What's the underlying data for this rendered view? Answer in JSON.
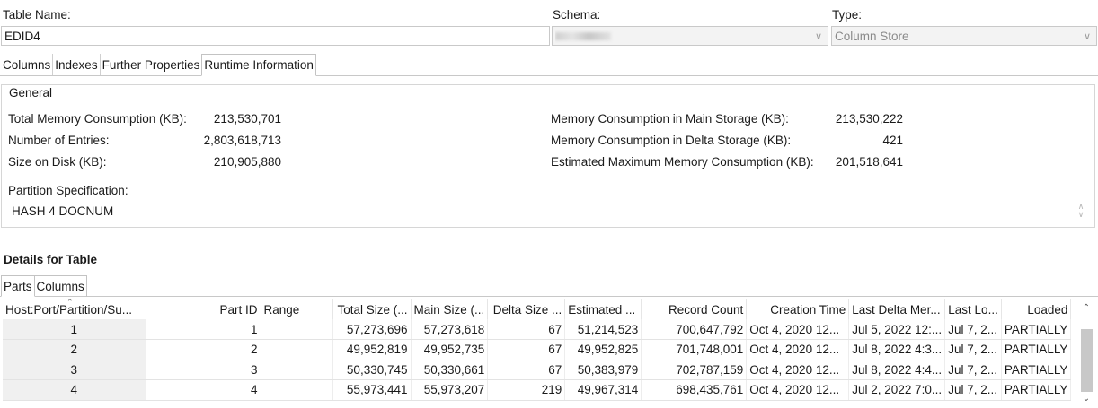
{
  "header": {
    "table_name_label": "Table Name:",
    "table_name_value": "EDID4",
    "schema_label": "Schema:",
    "type_label": "Type:",
    "type_value": "Column Store"
  },
  "tabs": [
    "Columns",
    "Indexes",
    "Further Properties",
    "Runtime Information"
  ],
  "active_tab": "Runtime Information",
  "general": {
    "title": "General",
    "left": [
      {
        "label": "Total Memory Consumption (KB):",
        "value": "213,530,701"
      },
      {
        "label": "Number of Entries:",
        "value": "2,803,618,713"
      },
      {
        "label": "Size on Disk (KB):",
        "value": "210,905,880"
      }
    ],
    "right": [
      {
        "label": "Memory Consumption in Main Storage (KB):",
        "value": "213,530,222"
      },
      {
        "label": "Memory Consumption in Delta Storage (KB):",
        "value": "421"
      },
      {
        "label": "Estimated Maximum Memory Consumption (KB):",
        "value": "201,518,641"
      }
    ],
    "partition_label": "Partition Specification:",
    "partition_value": "HASH 4 DOCNUM"
  },
  "details": {
    "title": "Details for Table",
    "subtabs": [
      "Parts",
      "Columns"
    ],
    "active_subtab": "Parts",
    "columns": [
      "Host:Port/Partition/Su...",
      "Part ID",
      "Range",
      "Total Size (...",
      "Main Size (...",
      "Delta Size ...",
      "Estimated ...",
      "Record Count",
      "Creation Time",
      "Last Delta Mer...",
      "Last Lo...",
      "Loaded"
    ],
    "rows": [
      [
        "1",
        "1",
        "",
        "57,273,696",
        "57,273,618",
        "67",
        "51,214,523",
        "700,647,792",
        "Oct 4, 2020 12...",
        "Jul 5, 2022 12:...",
        "Jul 7, 2...",
        "PARTIALLY"
      ],
      [
        "2",
        "2",
        "",
        "49,952,819",
        "49,952,735",
        "67",
        "49,952,825",
        "701,748,001",
        "Oct 4, 2020 12...",
        "Jul 8, 2022 4:3...",
        "Jul 7, 2...",
        "PARTIALLY"
      ],
      [
        "3",
        "3",
        "",
        "50,330,745",
        "50,330,661",
        "67",
        "50,383,979",
        "702,787,159",
        "Oct 4, 2020 12...",
        "Jul 8, 2022 4:4...",
        "Jul 7, 2...",
        "PARTIALLY"
      ],
      [
        "4",
        "4",
        "",
        "55,973,441",
        "55,973,207",
        "219",
        "49,967,314",
        "698,435,761",
        "Oct 4, 2020 12...",
        "Jul 2, 2022 7:0...",
        "Jul 7, 2...",
        "PARTIALLY"
      ]
    ]
  },
  "icons": {
    "dropdown": "chevron-down-icon",
    "spinner": "spinner-arrows-icon",
    "scroll_up": "scroll-up-icon",
    "scroll_down": "scroll-down-icon"
  }
}
